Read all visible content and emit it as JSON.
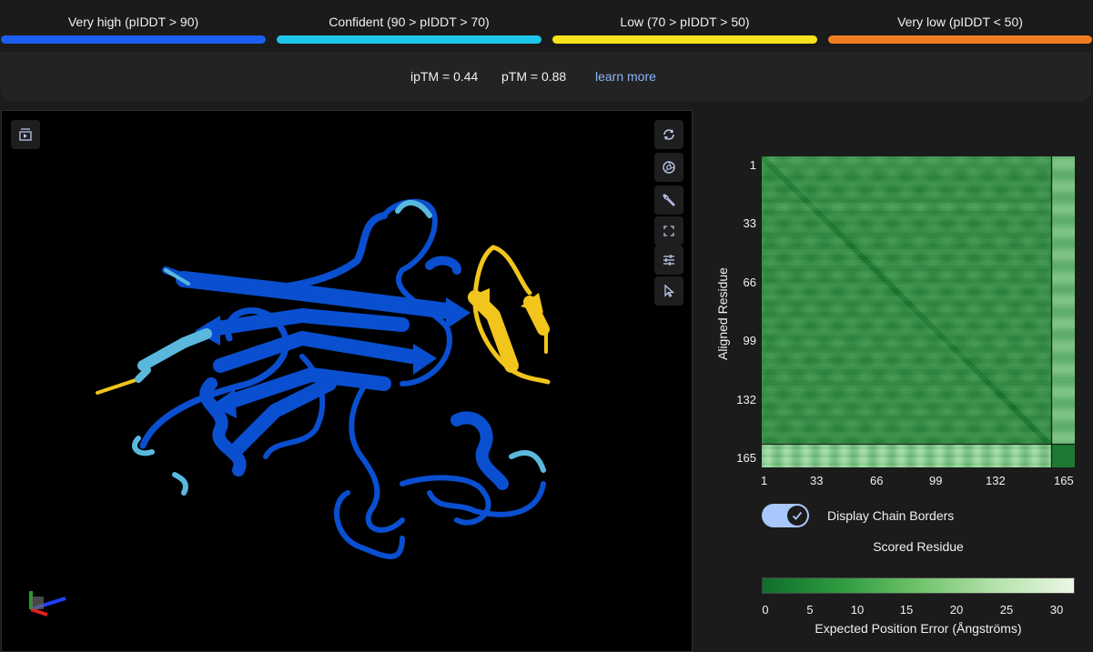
{
  "legend": {
    "items": [
      {
        "label": "Very high (pIDDT > 90)",
        "color": "#1a5ff0"
      },
      {
        "label": "Confident (90 > pIDDT > 70)",
        "color": "#1cc6e8"
      },
      {
        "label": "Low (70 > pIDDT > 50)",
        "color": "#f7e21b"
      },
      {
        "label": "Very low (pIDDT < 50)",
        "color": "#ee7d22"
      }
    ]
  },
  "metrics": {
    "iptm": "ipTM = 0.44",
    "ptm": "pTM = 0.88",
    "learn_more": "learn more"
  },
  "viewer": {
    "toolbar": [
      {
        "name": "play-sequence-button",
        "icon": "play-layers-icon"
      },
      {
        "name": "reset-rotation-button",
        "icon": "rotate-icon"
      },
      {
        "name": "camera-button",
        "icon": "aperture-icon"
      },
      {
        "name": "tools-button",
        "icon": "wrench-icon"
      },
      {
        "name": "fullscreen-button",
        "icon": "expand-icon"
      },
      {
        "name": "settings-button",
        "icon": "sliders-icon"
      },
      {
        "name": "select-mode-button",
        "icon": "cursor-icon"
      }
    ],
    "colors": {
      "very_high": "#0a4fd0",
      "confident": "#5ab8dc",
      "low": "#f1c51c"
    }
  },
  "pae": {
    "y_axis_label": "Aligned Residue",
    "x_axis_label": "Scored Residue",
    "y_ticks": [
      "1",
      "33",
      "66",
      "99",
      "132",
      "165"
    ],
    "x_ticks": [
      "1",
      "33",
      "66",
      "99",
      "132",
      "165"
    ],
    "chain_border_fraction": 0.925,
    "toggle_label": "Display Chain Borders",
    "toggle_on": true,
    "colorbar_ticks": [
      "0",
      "5",
      "10",
      "15",
      "20",
      "25",
      "30"
    ],
    "colorbar_title": "Expected Position Error (Ångströms)",
    "colors": {
      "low_error": "#0f6e2a",
      "high_error": "#eaf7e6"
    }
  }
}
